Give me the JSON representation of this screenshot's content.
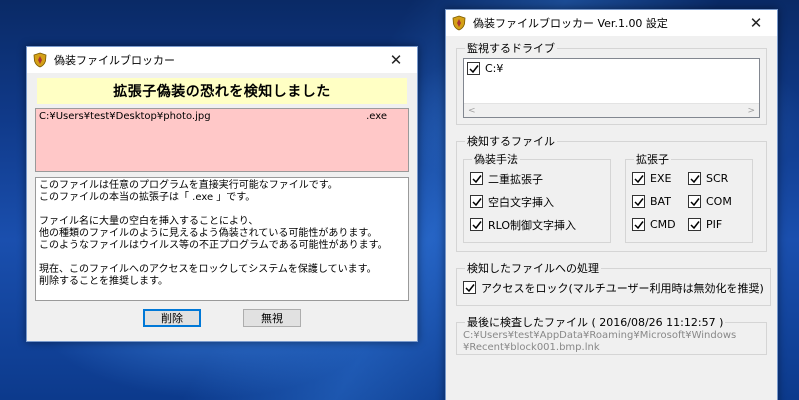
{
  "alert": {
    "title": "偽装ファイルブロッカー",
    "heading": "拡張子偽装の恐れを検知しました",
    "path": "C:¥Users¥test¥Desktop¥photo.jpg",
    "path_ext": ".exe",
    "message": "このファイルは任意のプログラムを直接実行可能なファイルです。\nこのファイルの本当の拡張子は「 .exe 」です。\n\nファイル名に大量の空白を挿入することにより、\n他の種類のファイルのように見えるよう偽装されている可能性があります。\nこのようなファイルはウイルス等の不正プログラムである可能性があります。\n\n現在、このファイルへのアクセスをロックしてシステムを保護しています。\n削除することを推奨します。",
    "delete_label": "削除",
    "ignore_label": "無視"
  },
  "settings": {
    "title": "偽装ファイルブロッカー Ver.1.00 設定",
    "drives_legend": "監視するドライブ",
    "drives": [
      {
        "label": "C:¥",
        "checked": true
      }
    ],
    "detect_legend": "検知するファイル",
    "method_legend": "偽装手法",
    "methods": [
      {
        "label": "二重拡張子",
        "checked": true
      },
      {
        "label": "空白文字挿入",
        "checked": true
      },
      {
        "label": "RLO制御文字挿入",
        "checked": true
      }
    ],
    "ext_legend": "拡張子",
    "extensions": [
      {
        "label": "EXE",
        "checked": true
      },
      {
        "label": "SCR",
        "checked": true
      },
      {
        "label": "BAT",
        "checked": true
      },
      {
        "label": "COM",
        "checked": true
      },
      {
        "label": "CMD",
        "checked": true
      },
      {
        "label": "PIF",
        "checked": true
      }
    ],
    "action_legend": "検知したファイルへの処理",
    "lock_label": "アクセスをロック(マルチユーザー利用時は無効化を推奨)",
    "lock_checked": true,
    "last_scan_legend": "最後に検査したファイル ( 2016/08/26 11:12:57 )",
    "last_scan_line1": "C:¥Users¥test¥AppData¥Roaming¥Microsoft¥Windows",
    "last_scan_line2": "¥Recent¥block001.bmp.lnk"
  },
  "colors": {
    "heading_bg": "#ffffc4",
    "path_bg": "#ffc8c8",
    "accent": "#0078d7"
  },
  "icons": {
    "app": "shield-icon",
    "close": "close-icon",
    "check": "checkmark-icon"
  }
}
